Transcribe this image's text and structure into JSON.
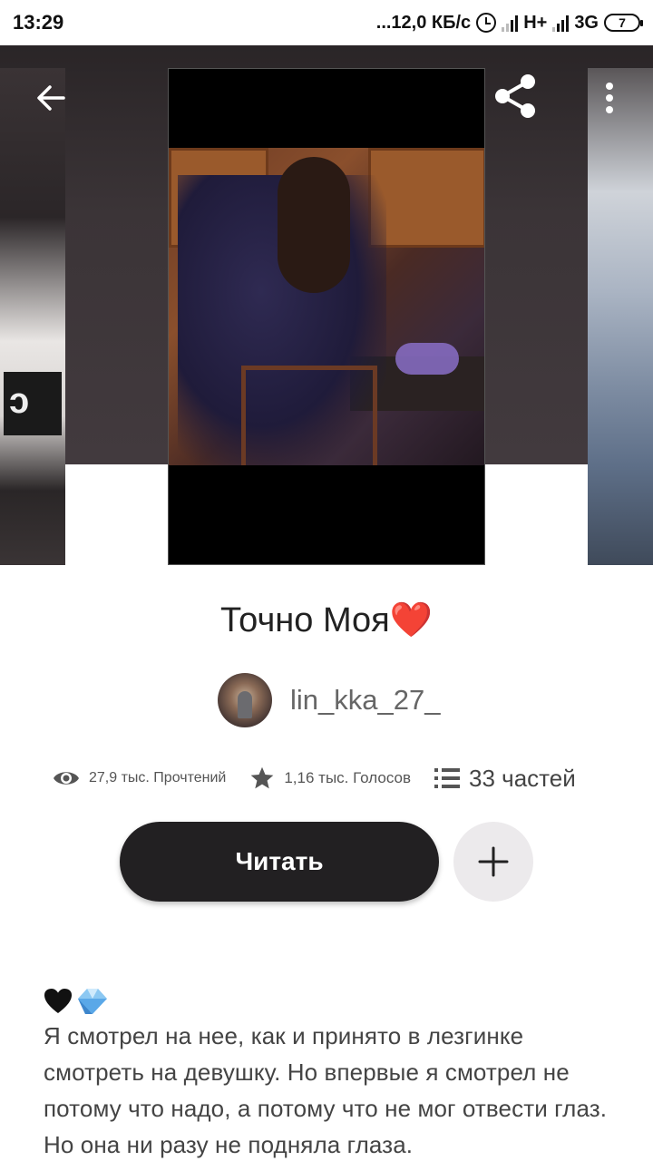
{
  "status_bar": {
    "time": "13:29",
    "net_speed": "...12,0 КБ/с",
    "network_1": "H+",
    "network_2": "3G",
    "battery": "7"
  },
  "icons": {
    "back": "arrow-left-icon",
    "share": "share-icon",
    "more": "more-vertical-icon",
    "views": "eye-icon",
    "votes": "star-icon",
    "parts": "list-icon",
    "add": "plus-icon",
    "heart": "black-heart-emoji",
    "diamond": "diamond-emoji"
  },
  "story": {
    "title": "Точно Моя❤️",
    "author": "lin_kka_27_",
    "reads": "27,9 тыс. Прочтений",
    "votes": "1,16 тыс. Голосов",
    "parts": "33 частей"
  },
  "actions": {
    "read_label": "Читать"
  },
  "description": {
    "text": "Я смотрел на нее, как и принято в лезгинке смотреть на девушку. Но впервые я смотрел не потому что надо, а потому что не мог отвести глаз. Но она ни разу не подняла глаза."
  },
  "colors": {
    "primary_button": "#222022",
    "hero_background": "#3b3437",
    "heart": "#e53e30",
    "diamond": "#5aa8e8"
  }
}
